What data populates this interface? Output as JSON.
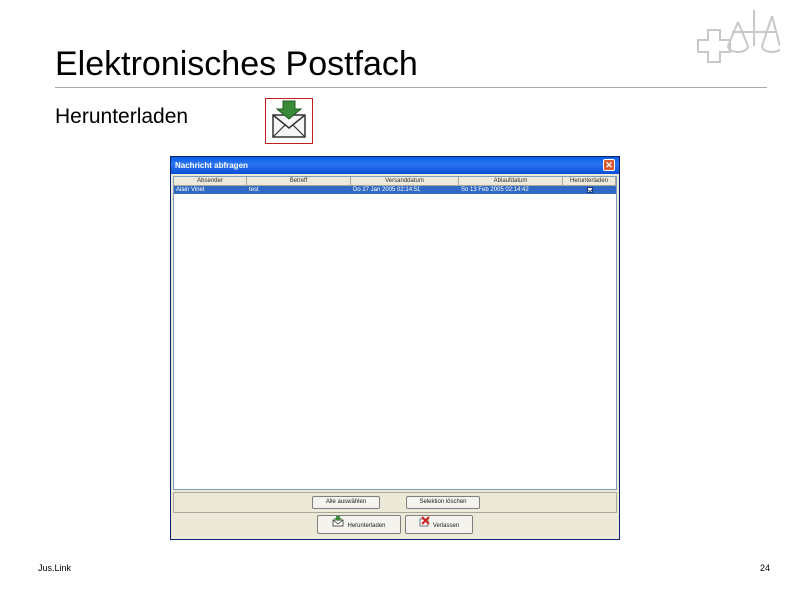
{
  "slide": {
    "title": "Elektronisches Postfach",
    "subtitle": "Herunterladen",
    "footer_left": "Jus.Link",
    "page_number": "24"
  },
  "window": {
    "title": "Nachricht abfragen",
    "close_glyph": "✕",
    "columns": [
      "Absender",
      "Betreff",
      "Versanddatum",
      "Ablaufdatum",
      "Herunterladen"
    ],
    "rows": [
      {
        "absender": "Alain Vinet",
        "betreff": "test",
        "versanddatum": "Do 27 Jan 2005 02:14:51",
        "ablaufdatum": "So 13 Feb 2005 02:14:42",
        "herunterladen": true
      }
    ],
    "buttons": {
      "select_all": "Alle auswählen",
      "clear_selection": "Selektion löschen",
      "download": "Herunterladen",
      "leave": "Verlassen"
    }
  },
  "colors": {
    "titlebar": "#0a5ee8",
    "selection": "#316ac5",
    "window_bg": "#ece9d8",
    "icon_border": "#c02020",
    "arrow_green": "#3a8a3a"
  },
  "icons": [
    "swiss-cross-scales-logo",
    "download-mail-icon",
    "close-icon",
    "checkbox-checked-icon",
    "download-icon",
    "leave-icon"
  ]
}
